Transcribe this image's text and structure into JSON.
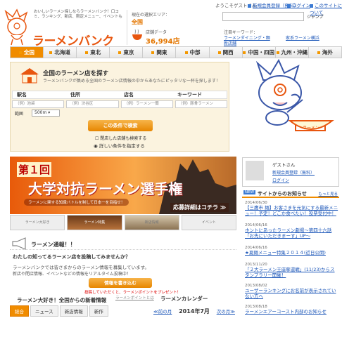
{
  "topbar": {
    "greeting": "ようこそゲストさん",
    "register": "新規会員登録（無料）",
    "login": "ログイン",
    "about": "このサイトについて"
  },
  "logo": {
    "tagline": "おいしいラーメン探しならラーメンバンク！口コミ、ランキング、新店、限定メニュー、イベントも",
    "wordmark": "ラーメンバンク"
  },
  "stats": {
    "area_label": "現在の選択エリア：",
    "area_value": "全国",
    "count_label": "店舗データ",
    "count_value": "36,994店"
  },
  "top_search": {
    "checkbox": "ジャンプ",
    "keywords_label": "注目キーワード：",
    "k1": "ラーメンダイニング・麺",
    "k2": "新店舗",
    "k3": "家系ラーメン横浜"
  },
  "nav": {
    "items": [
      "全国",
      "北海道",
      "東北",
      "東京",
      "関東",
      "中部",
      "関西",
      "中国・四国",
      "九州・沖縄",
      "海外"
    ]
  },
  "search_panel": {
    "title": "全国のラーメン店を探す",
    "desc": "ラーメンバンクが集める全国のラーメン店情報の中からあなたにピッタリな一杯を探します！",
    "headers": [
      "駅名",
      "住所",
      "店名",
      "キーワード"
    ],
    "placeholders": [
      "（例）池袋",
      "（例）渋谷区",
      "（例）ラーメン一蘭",
      "（例）豚骨ラーメン"
    ],
    "count_label": "範囲",
    "count_value": "500m",
    "search_button": "この条件で検索",
    "opt1": "閉店した店舗も検索する",
    "opt2": "詳しい条件を指定する"
  },
  "banner": {
    "round": "第１回",
    "title": "大学対抗ラーメン選手権",
    "sub": "ラーメンに関する知識バトルを制して日本一を目指せ！",
    "cta": "応募詳細はコチラ ≫"
  },
  "thumbs": [
    "ラーメン大好き",
    "ラーメン特集",
    "新店情報",
    "イベント"
  ],
  "news_section": {
    "title": "ラーメン通報！！",
    "p1": "わたしの知ってるラーメン店を投稿してみませんか？",
    "p2": "ラーメンバンクでは皆さまからのラーメン情報を募集しています。",
    "p3": "新店や閉店情報、イベントなどの情報をリアルタイム投稿中！",
    "button": "情報を書き込む",
    "red": "投稿していただくと、ラーメンポイントをプレゼント！",
    "gray": "ラーメンポイントとは"
  },
  "rank": {
    "title": "ラーメン大好き！全国からの新着情報",
    "tabs": [
      "総合",
      "ニュース",
      "新店情報",
      "新作"
    ]
  },
  "calendar": {
    "title": "ラーメンカレンダー",
    "prev": "≪前の月",
    "month": "2014年7月",
    "next": "次の月≫"
  },
  "login_box": {
    "name": "ゲストさん",
    "register": "新規会員登録（無料）",
    "login": "ログイン"
  },
  "site_news": {
    "badge": "NEW",
    "title": "サイトからのお知らせ",
    "more": "もっと見る",
    "items": [
      {
        "date": "2014/06/30",
        "text": "【三鷹市 麺】お客さまを元気にする最新メニュー！予定！どこか食べたい！投票受付中！"
      },
      {
        "date": "2014/06/16",
        "text": "ホントにあったラーメン劇場〜第四十六話「お先にいただきまーす」UP〜"
      },
      {
        "date": "2014/06/16",
        "text": "★夏麺メニュー特集２０１４(近日公開)"
      },
      {
        "date": "2013/11/20",
        "text": "「２大ラーメン王座奪還戦」(11/23)からスタンプラリー開催！"
      },
      {
        "date": "2013/08/02",
        "text": "ユーザーランキングにお名前が表示されていない方へ"
      },
      {
        "date": "2013/08/18",
        "text": "ラーメンエアーコースト内部のお知らせ"
      }
    ]
  },
  "colors": {
    "accent": "#f08c00",
    "link": "#1a55b8",
    "brand": "#e8560f"
  }
}
